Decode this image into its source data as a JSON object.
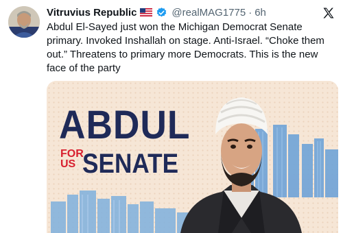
{
  "tweet": {
    "display_name": "Vitruvius Republic",
    "handle": "@realMAG1775",
    "separator": "·",
    "time": "6h",
    "text": "Abdul El-Sayed just won the Michigan Democrat Senate primary. Invoked Inshallah on stage. Anti-Israel. “Choke them out.” Threatens to primary more Democrats. This is the new face of the party"
  },
  "icons": {
    "flag": "us-flag-icon",
    "verified": "verified-badge-icon",
    "logo": "x-logo-icon"
  },
  "media": {
    "headline": "ABDUL",
    "for_us": "FOR US",
    "senate": "SENATE"
  },
  "colors": {
    "navy": "#1f2a58",
    "red": "#d81f2e",
    "verified_blue": "#1d9bf0",
    "background_peach": "#f6e6d6"
  }
}
